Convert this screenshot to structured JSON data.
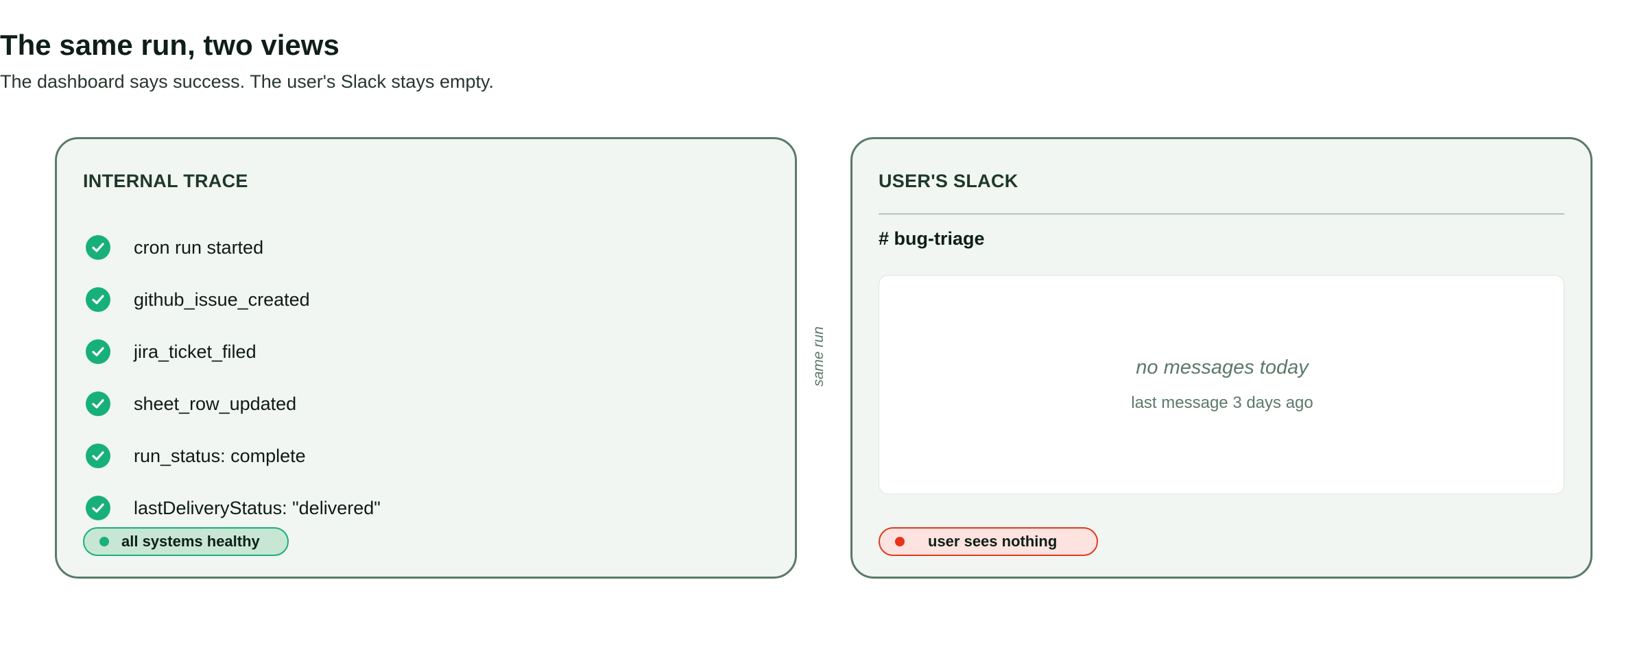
{
  "header": {
    "title": "The same run, two views",
    "subtitle": "The dashboard says success. The user's Slack stays empty."
  },
  "internal_trace": {
    "heading": "INTERNAL TRACE",
    "items": [
      {
        "label": "cron run started",
        "icon": "check-circle-icon"
      },
      {
        "label": "github_issue_created",
        "icon": "check-circle-icon"
      },
      {
        "label": "jira_ticket_filed",
        "icon": "check-circle-icon"
      },
      {
        "label": "sheet_row_updated",
        "icon": "check-circle-icon"
      },
      {
        "label": "run_status: complete",
        "icon": "check-circle-icon"
      },
      {
        "label": "lastDeliveryStatus: \"delivered\"",
        "icon": "check-circle-icon"
      }
    ],
    "status": {
      "label": "all systems healthy",
      "color": "#18b07a"
    }
  },
  "connector": {
    "label": "same run"
  },
  "users_slack": {
    "heading": "USER'S SLACK",
    "channel": "# bug-triage",
    "empty_title": "no messages today",
    "empty_subtitle": "last message 3 days ago",
    "status": {
      "label": "user sees nothing",
      "color": "#e8341a"
    }
  },
  "colors": {
    "panel_bg": "#f1f6f2",
    "panel_border": "#5a7a68",
    "success": "#18b07a",
    "danger": "#e8341a",
    "muted_text": "#5b7a69"
  }
}
